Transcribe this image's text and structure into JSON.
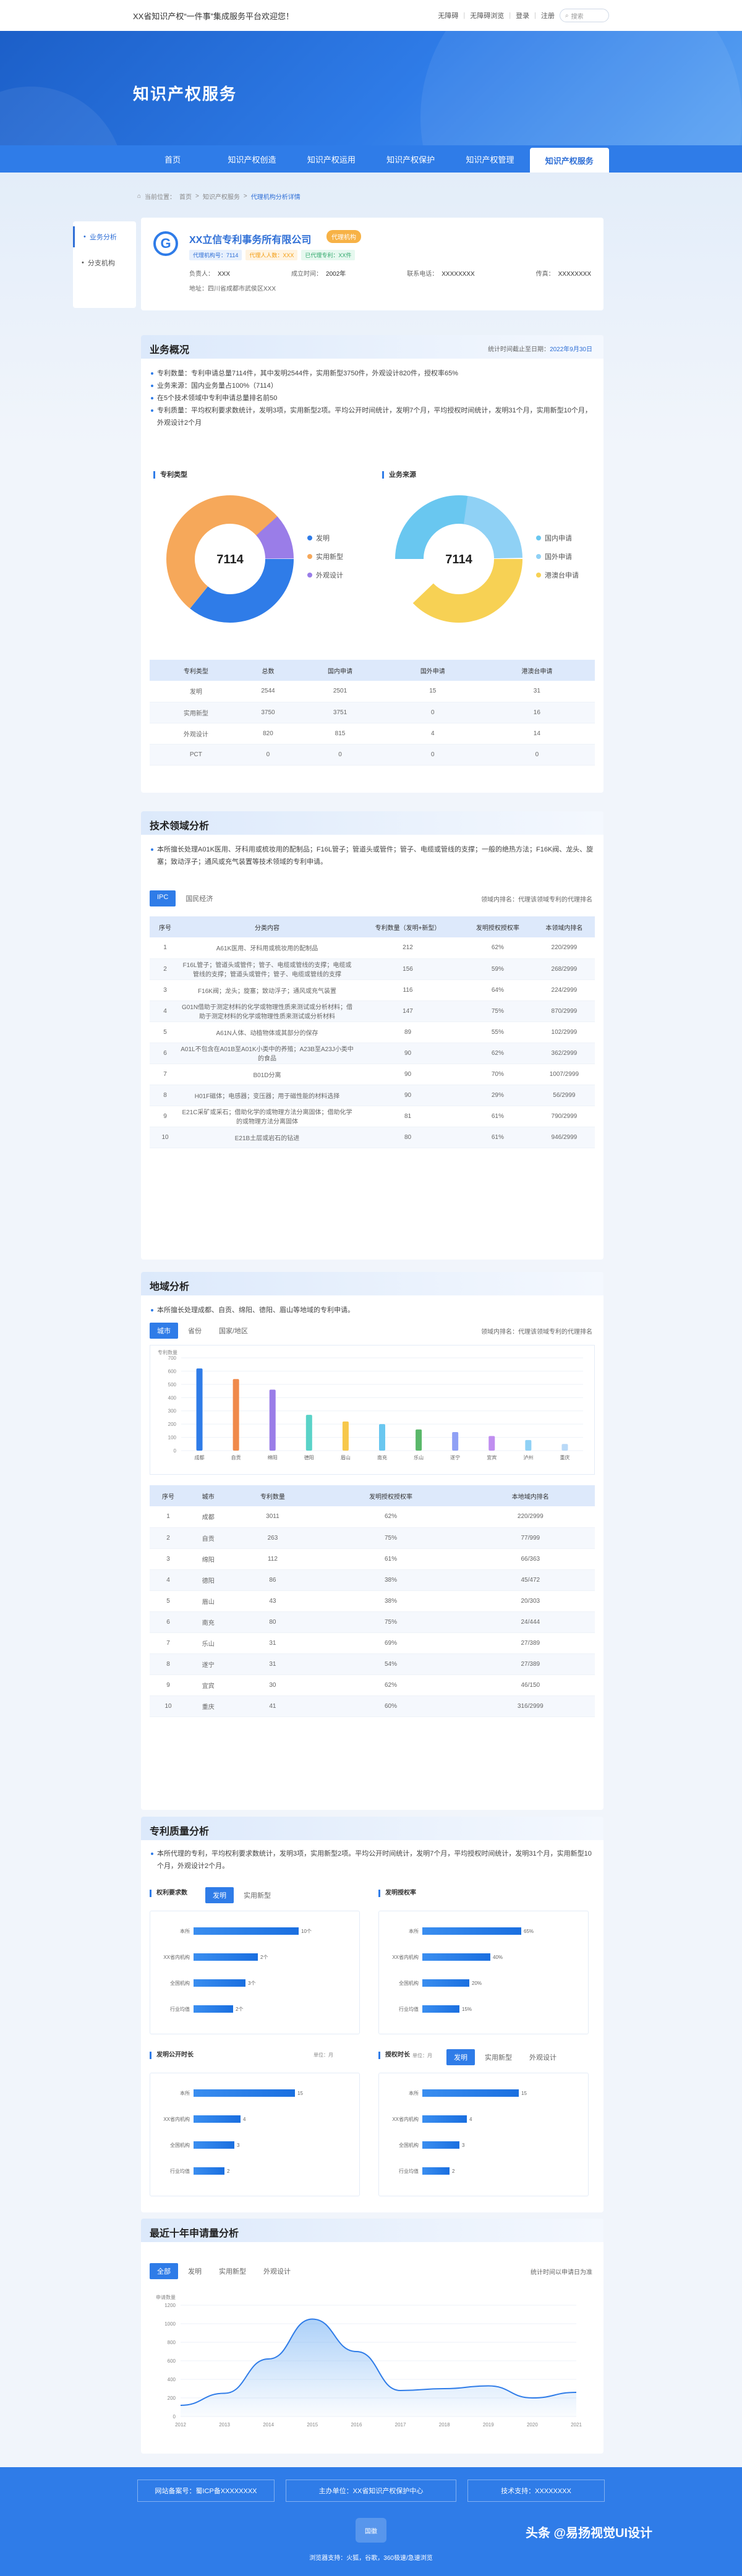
{
  "topbar": {
    "welcome": "XX省知识产权“一件事”集成服务平台欢迎您！",
    "links": [
      "无障碍",
      "|",
      "无障碍浏览",
      "|",
      "登录",
      "|",
      "注册"
    ],
    "search": "搜索"
  },
  "hero": {
    "title": "知识产权服务"
  },
  "nav": [
    "首页",
    "知识产权创造",
    "知识产权运用",
    "知识产权保护",
    "知识产权管理",
    "知识产权服务"
  ],
  "crumb": [
    "当前位置：",
    "首页",
    ">",
    "知识产权服务",
    ">",
    "代理机构分析详情"
  ],
  "sidebar": [
    "业务分析",
    "分支机构"
  ],
  "org": {
    "name": "XX立信专利事务所有限公司",
    "badge": "代理机构",
    "tags": [
      "代理机构号：7114",
      "代理人人数：XXX",
      "已代理专利：XX件"
    ],
    "meta": [
      [
        "负责人：",
        "XXX"
      ],
      [
        "成立时间：",
        "2002年"
      ],
      [
        "联系电话：",
        "XXXXXXXX"
      ],
      [
        "传真：",
        "XXXXXXXX"
      ]
    ],
    "address": "地址：四川省成都市武侯区XXX"
  },
  "business": {
    "title": "业务概况",
    "right_label": "统计时间截止至日期：",
    "right_date": "2022年9月30日",
    "bullets": [
      "专利数量：专利申请总量7114件，其中发明2544件，实用新型3750件，外观设计820件，授权率65%",
      "业务来源：国内业务量占100%（7114）",
      "在5个技术领域中专利申请总量排名前50",
      "专利质量：平均权利要求数统计，发明3项，实用新型2项。平均公开时间统计，发明7个月，平均授权时间统计，发明31个月，实用新型10个月，外观设计2个月"
    ]
  },
  "pie1": {
    "title": "专利类型",
    "total": "7114",
    "legend": [
      "发明",
      "实用新型",
      "外观设计"
    ]
  },
  "pie2": {
    "title": "业务来源",
    "total": "7114",
    "legend": [
      "国内申请",
      "国外申请",
      "港澳台申请"
    ]
  },
  "colors": {
    "blue": "#2f7ce8",
    "orange": "#f6a85a",
    "purple": "#9a7de8",
    "cyan": "#69c7f0",
    "yellow": "#f7d154",
    "sky": "#8fd1f5"
  },
  "type_table": {
    "headers": [
      "专利类型",
      "总数",
      "国内申请",
      "国外申请",
      "港澳台申请"
    ],
    "rows": [
      [
        "发明",
        "2544",
        "2501",
        "15",
        "31"
      ],
      [
        "实用新型",
        "3750",
        "3751",
        "0",
        "16"
      ],
      [
        "外观设计",
        "820",
        "815",
        "4",
        "14"
      ],
      [
        "PCT",
        "0",
        "0",
        "0",
        "0"
      ]
    ]
  },
  "tech": {
    "title": "技术领域分析",
    "desc": "本所擅长处理A01K医用、牙科用或梳妆用的配制品；F16L管子；管道头或管件；管子、电缆或管线的支撑；一般的绝热方法；F16K阀、龙头、旋塞；致动浮子；通风或充气装置等技术领域的专利申请。",
    "right": "领域内排名：代理该领域专利的代理排名",
    "tabs": [
      "IPC",
      "国民经济"
    ],
    "headers": [
      "序号",
      "分类内容",
      "专利数量（发明+新型）",
      "发明授权授权率",
      "本领域内排名"
    ],
    "rows": [
      [
        "1",
        "A61K医用、牙科用或梳妆用的配制品",
        "212",
        "62%",
        "220/2999"
      ],
      [
        "2",
        "F16L管子；管道头或管件；管子、电缆或管线的支撑；电缆或管线的支撑；管道头或管件；管子、电缆或管线的支撑",
        "156",
        "59%",
        "268/2999"
      ],
      [
        "3",
        "F16K阀；龙头；旋塞；致动浮子；通风或充气装置",
        "116",
        "64%",
        "224/2999"
      ],
      [
        "4",
        "G01N借助于测定材料的化学或物理性质来测试或分析材料；借助于测定材料的化学或物理性质来测试或分析材料",
        "147",
        "75%",
        "870/2999"
      ],
      [
        "5",
        "A61N人体、动植物体或其部分的保存",
        "89",
        "55%",
        "102/2999"
      ],
      [
        "6",
        "A01L不包含在A01B至A01K小类中的养殖；A23B至A23J小类中的食品",
        "90",
        "62%",
        "362/2999"
      ],
      [
        "7",
        "B01D分离",
        "90",
        "70%",
        "1007/2999"
      ],
      [
        "8",
        "H01F磁体；电感器；变压器；用于磁性能的材料选择",
        "90",
        "29%",
        "56/2999"
      ],
      [
        "9",
        "E21C采矿或采石；借助化学的或物理方法分离固体；借助化学的或物理方法分离固体",
        "81",
        "61%",
        "790/2999"
      ],
      [
        "10",
        "E21B土层或岩石的钻进",
        "80",
        "61%",
        "946/2999"
      ]
    ]
  },
  "region": {
    "title": "地域分析",
    "desc": "本所擅长处理成都、自贡、绵阳、德阳、眉山等地域的专利申请。",
    "right": "领域内排名：代理该领域专利的代理排名",
    "tabs": [
      "城市",
      "省份",
      "国家/地区"
    ],
    "chart_data": {
      "type": "bar",
      "ylabel": "专利数量",
      "ylim": [
        0,
        700
      ],
      "yticks": [
        "0",
        "100",
        "200",
        "300",
        "400",
        "500",
        "600",
        "700"
      ],
      "categories": [
        "成都",
        "自贡",
        "绵阳",
        "德阳",
        "眉山",
        "南充",
        "乐山",
        "遂宁",
        "宜宾",
        "泸州",
        "重庆"
      ],
      "values": [
        620,
        540,
        460,
        270,
        220,
        200,
        160,
        140,
        110,
        80,
        50
      ]
    },
    "headers": [
      "序号",
      "城市",
      "专利数量",
      "发明授权授权率",
      "本地域内排名"
    ],
    "rows": [
      [
        "1",
        "成都",
        "3011",
        "62%",
        "220/2999"
      ],
      [
        "2",
        "自贡",
        "263",
        "75%",
        "77/999"
      ],
      [
        "3",
        "绵阳",
        "112",
        "61%",
        "66/363"
      ],
      [
        "4",
        "德阳",
        "86",
        "38%",
        "45/472"
      ],
      [
        "5",
        "眉山",
        "43",
        "38%",
        "20/303"
      ],
      [
        "6",
        "南充",
        "80",
        "75%",
        "24/444"
      ],
      [
        "7",
        "乐山",
        "31",
        "69%",
        "27/389"
      ],
      [
        "8",
        "遂宁",
        "31",
        "54%",
        "27/389"
      ],
      [
        "9",
        "宜宾",
        "30",
        "62%",
        "46/150"
      ],
      [
        "10",
        "重庆",
        "41",
        "60%",
        "316/2999"
      ]
    ]
  },
  "quality": {
    "title": "专利质量分析",
    "desc": "本所代理的专利，平均权利要求数统计，发明3项，实用新型2项。平均公开时间统计，发明7个月，平均授权时间统计，发明31个月，实用新型10个月，外观设计2个月。",
    "q1": {
      "title": "权利要求数",
      "tabs": [
        "发明",
        "实用新型"
      ],
      "labels": [
        "本所",
        "XX省内机构",
        "全国机构",
        "行业均值"
      ],
      "vals": [
        "10个",
        "2个",
        "3个",
        "2个"
      ],
      "fill": [
        0.85,
        0.52,
        0.42,
        0.32
      ]
    },
    "q2": {
      "title": "发明授权率",
      "labels": [
        "本所",
        "XX省内机构",
        "全国机构",
        "行业均值"
      ],
      "vals": [
        "65%",
        "40%",
        "20%",
        "15%"
      ],
      "fill": [
        0.8,
        0.55,
        0.38,
        0.3
      ]
    },
    "q3": {
      "title": "发明公开时长",
      "unit": "单位：月",
      "labels": [
        "本所",
        "XX省内机构",
        "全国机构",
        "行业均值"
      ],
      "vals": [
        "15",
        "4",
        "3",
        "2"
      ],
      "fill": [
        0.82,
        0.38,
        0.33,
        0.25
      ]
    },
    "q4": {
      "title": "授权时长",
      "unit": "单位：月",
      "tabs": [
        "发明",
        "实用新型",
        "外观设计"
      ],
      "labels": [
        "本所",
        "XX省内机构",
        "全国机构",
        "行业均值"
      ],
      "vals": [
        "15",
        "4",
        "3",
        "2"
      ],
      "fill": [
        0.78,
        0.36,
        0.3,
        0.22
      ]
    }
  },
  "trend": {
    "title": "最近十年申请量分析",
    "tabs": [
      "全部",
      "发明",
      "实用新型",
      "外观设计"
    ],
    "right": "统计时间以申请日为准",
    "chart_data": {
      "type": "area",
      "ylabel": "申请数量",
      "yticks": [
        "0",
        "200",
        "400",
        "600",
        "800",
        "1000",
        "1200"
      ],
      "ylim": [
        0,
        1200
      ],
      "x": [
        "2012",
        "2013",
        "2014",
        "2015",
        "2016",
        "2017",
        "2018",
        "2019",
        "2020",
        "2021"
      ],
      "values": [
        120,
        250,
        620,
        1050,
        700,
        280,
        300,
        330,
        200,
        260
      ]
    }
  },
  "footer": {
    "boxes": [
      "网站备案号：蜀ICP备XXXXXXXX",
      "主办单位：XX省知识产权保护中心",
      "技术支持：XXXXXXXX"
    ],
    "logo": "国徽",
    "note": "浏览器支持：火狐，谷歌，360极速/急速浏览",
    "wm": "头条 @易扬视觉UI设计"
  }
}
